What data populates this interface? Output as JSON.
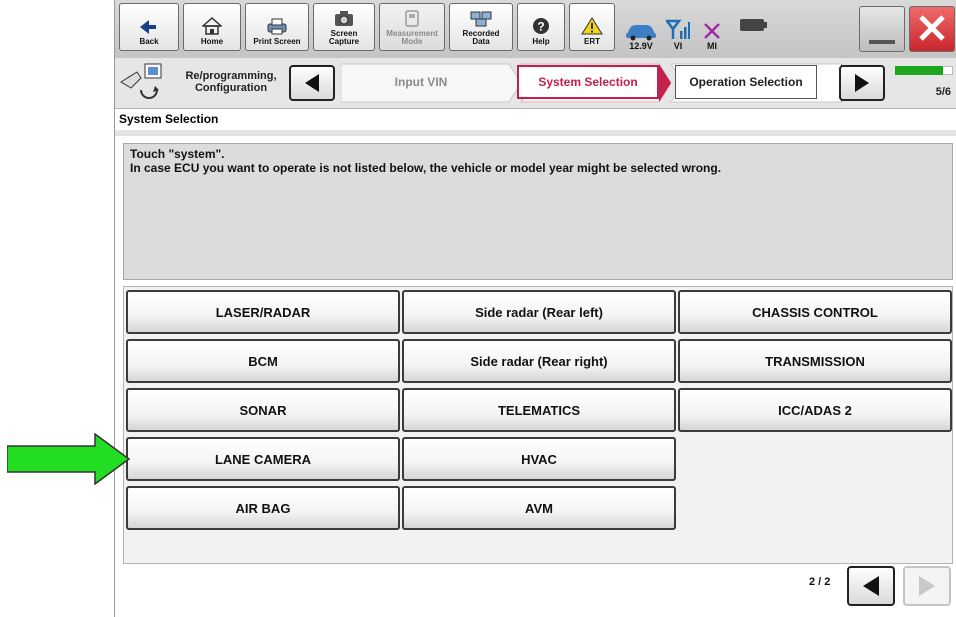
{
  "toolbar": {
    "back": "Back",
    "home": "Home",
    "print_screen": "Print Screen",
    "screen_capture": "Screen Capture",
    "measurement_mode": "Measurement Mode",
    "recorded_data": "Recorded Data",
    "help": "Help",
    "ert": "ERT",
    "voltage": "12.9V",
    "vi": "VI",
    "mi": "MI"
  },
  "nav": {
    "section_label": "Re/programming, Configuration",
    "steps": [
      {
        "label": "Input VIN",
        "state": "inactive"
      },
      {
        "label": "System Selection",
        "state": "active"
      },
      {
        "label": "Operation Selection",
        "state": "next"
      }
    ],
    "progress_text": "5/6",
    "progress_fraction": 0.83
  },
  "page_title": "System Selection",
  "message": {
    "line1": "Touch \"system\".",
    "line2": "In case ECU you want to operate is not listed below, the vehicle or model year might be selected wrong."
  },
  "systems": [
    "LASER/RADAR",
    "Side radar (Rear left)",
    "CHASSIS CONTROL",
    "BCM",
    "Side radar (Rear right)",
    "TRANSMISSION",
    "SONAR",
    "TELEMATICS",
    "ICC/ADAS 2",
    "LANE CAMERA",
    "HVAC",
    "AIR BAG",
    "AVM"
  ],
  "pager": {
    "text": "2 / 2"
  },
  "colors": {
    "active_step": "#c2214c",
    "pointer_arrow": "#22dd22",
    "progress": "#1ea71e"
  }
}
